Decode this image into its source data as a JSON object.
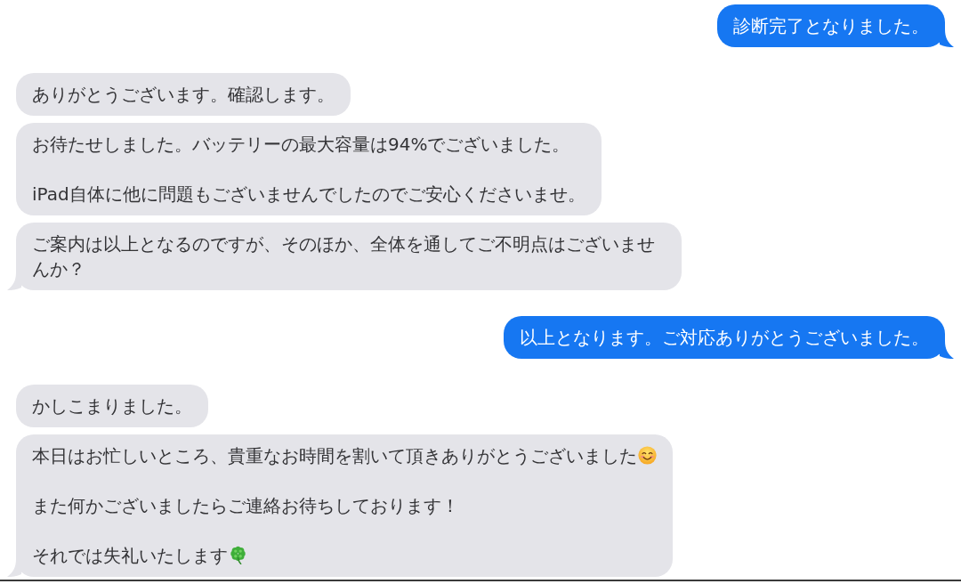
{
  "messages": [
    {
      "kind": "sent",
      "paragraphs": [
        {
          "kind": "plain",
          "text": "診断完了となりました。"
        }
      ]
    },
    {
      "kind": "received",
      "paragraphs": [
        {
          "kind": "plain",
          "text": "ありがとうございます。確認します。"
        }
      ]
    },
    {
      "kind": "received",
      "paragraphs": [
        {
          "kind": "plain",
          "text": "お待たせしました。バッテリーの最大容量は94%でございました。"
        },
        {
          "kind": "plain",
          "text": "iPad自体に他に問題もございませんでしたのでご安心くださいませ。"
        }
      ]
    },
    {
      "kind": "received",
      "paragraphs": [
        {
          "kind": "plain",
          "text": "ご案内は以上となるのですが、そのほか、全体を通してご不明点はございませんか？"
        }
      ]
    },
    {
      "kind": "sent",
      "paragraphs": [
        {
          "kind": "plain",
          "text": "以上となります。ご対応ありがとうございました。"
        }
      ]
    },
    {
      "kind": "received",
      "paragraphs": [
        {
          "kind": "plain",
          "text": "かしこまりました。"
        }
      ]
    },
    {
      "kind": "received",
      "paragraphs": [
        {
          "kind": "smiley",
          "text": "本日はお忙しいところ、貴重なお時間を割いて頂きありがとうございました"
        },
        {
          "kind": "plain",
          "text": "また何かございましたらご連絡お待ちしております！"
        },
        {
          "kind": "clover",
          "text": "それでは失礼いたします"
        }
      ]
    }
  ]
}
